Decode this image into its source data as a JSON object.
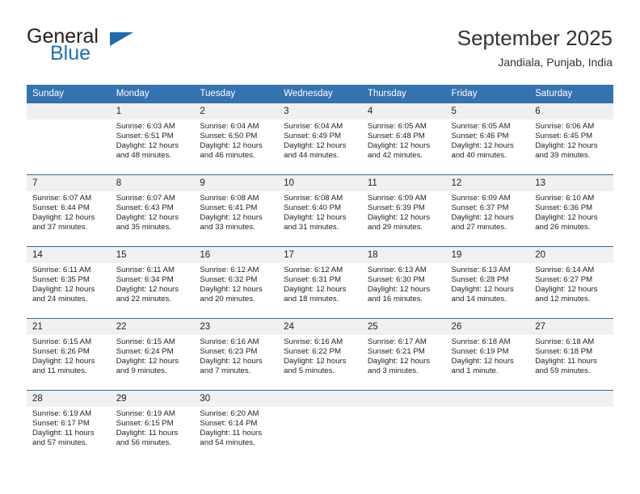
{
  "brand": {
    "word1": "General",
    "word2": "Blue",
    "accent_color": "#1c6cb0"
  },
  "header": {
    "month_title": "September 2025",
    "location": "Jandiala, Punjab, India",
    "header_bg": "#3572b0",
    "daynum_bg": "#f0f0f0",
    "row_border": "#2b6ca3"
  },
  "weekday_headers": [
    "Sunday",
    "Monday",
    "Tuesday",
    "Wednesday",
    "Thursday",
    "Friday",
    "Saturday"
  ],
  "weeks": [
    [
      {
        "day": "",
        "lines": []
      },
      {
        "day": "1",
        "lines": [
          "Sunrise: 6:03 AM",
          "Sunset: 6:51 PM",
          "Daylight: 12 hours",
          "and 48 minutes."
        ]
      },
      {
        "day": "2",
        "lines": [
          "Sunrise: 6:04 AM",
          "Sunset: 6:50 PM",
          "Daylight: 12 hours",
          "and 46 minutes."
        ]
      },
      {
        "day": "3",
        "lines": [
          "Sunrise: 6:04 AM",
          "Sunset: 6:49 PM",
          "Daylight: 12 hours",
          "and 44 minutes."
        ]
      },
      {
        "day": "4",
        "lines": [
          "Sunrise: 6:05 AM",
          "Sunset: 6:48 PM",
          "Daylight: 12 hours",
          "and 42 minutes."
        ]
      },
      {
        "day": "5",
        "lines": [
          "Sunrise: 6:05 AM",
          "Sunset: 6:46 PM",
          "Daylight: 12 hours",
          "and 40 minutes."
        ]
      },
      {
        "day": "6",
        "lines": [
          "Sunrise: 6:06 AM",
          "Sunset: 6:45 PM",
          "Daylight: 12 hours",
          "and 39 minutes."
        ]
      }
    ],
    [
      {
        "day": "7",
        "lines": [
          "Sunrise: 6:07 AM",
          "Sunset: 6:44 PM",
          "Daylight: 12 hours",
          "and 37 minutes."
        ]
      },
      {
        "day": "8",
        "lines": [
          "Sunrise: 6:07 AM",
          "Sunset: 6:43 PM",
          "Daylight: 12 hours",
          "and 35 minutes."
        ]
      },
      {
        "day": "9",
        "lines": [
          "Sunrise: 6:08 AM",
          "Sunset: 6:41 PM",
          "Daylight: 12 hours",
          "and 33 minutes."
        ]
      },
      {
        "day": "10",
        "lines": [
          "Sunrise: 6:08 AM",
          "Sunset: 6:40 PM",
          "Daylight: 12 hours",
          "and 31 minutes."
        ]
      },
      {
        "day": "11",
        "lines": [
          "Sunrise: 6:09 AM",
          "Sunset: 6:39 PM",
          "Daylight: 12 hours",
          "and 29 minutes."
        ]
      },
      {
        "day": "12",
        "lines": [
          "Sunrise: 6:09 AM",
          "Sunset: 6:37 PM",
          "Daylight: 12 hours",
          "and 27 minutes."
        ]
      },
      {
        "day": "13",
        "lines": [
          "Sunrise: 6:10 AM",
          "Sunset: 6:36 PM",
          "Daylight: 12 hours",
          "and 26 minutes."
        ]
      }
    ],
    [
      {
        "day": "14",
        "lines": [
          "Sunrise: 6:11 AM",
          "Sunset: 6:35 PM",
          "Daylight: 12 hours",
          "and 24 minutes."
        ]
      },
      {
        "day": "15",
        "lines": [
          "Sunrise: 6:11 AM",
          "Sunset: 6:34 PM",
          "Daylight: 12 hours",
          "and 22 minutes."
        ]
      },
      {
        "day": "16",
        "lines": [
          "Sunrise: 6:12 AM",
          "Sunset: 6:32 PM",
          "Daylight: 12 hours",
          "and 20 minutes."
        ]
      },
      {
        "day": "17",
        "lines": [
          "Sunrise: 6:12 AM",
          "Sunset: 6:31 PM",
          "Daylight: 12 hours",
          "and 18 minutes."
        ]
      },
      {
        "day": "18",
        "lines": [
          "Sunrise: 6:13 AM",
          "Sunset: 6:30 PM",
          "Daylight: 12 hours",
          "and 16 minutes."
        ]
      },
      {
        "day": "19",
        "lines": [
          "Sunrise: 6:13 AM",
          "Sunset: 6:28 PM",
          "Daylight: 12 hours",
          "and 14 minutes."
        ]
      },
      {
        "day": "20",
        "lines": [
          "Sunrise: 6:14 AM",
          "Sunset: 6:27 PM",
          "Daylight: 12 hours",
          "and 12 minutes."
        ]
      }
    ],
    [
      {
        "day": "21",
        "lines": [
          "Sunrise: 6:15 AM",
          "Sunset: 6:26 PM",
          "Daylight: 12 hours",
          "and 11 minutes."
        ]
      },
      {
        "day": "22",
        "lines": [
          "Sunrise: 6:15 AM",
          "Sunset: 6:24 PM",
          "Daylight: 12 hours",
          "and 9 minutes."
        ]
      },
      {
        "day": "23",
        "lines": [
          "Sunrise: 6:16 AM",
          "Sunset: 6:23 PM",
          "Daylight: 12 hours",
          "and 7 minutes."
        ]
      },
      {
        "day": "24",
        "lines": [
          "Sunrise: 6:16 AM",
          "Sunset: 6:22 PM",
          "Daylight: 12 hours",
          "and 5 minutes."
        ]
      },
      {
        "day": "25",
        "lines": [
          "Sunrise: 6:17 AM",
          "Sunset: 6:21 PM",
          "Daylight: 12 hours",
          "and 3 minutes."
        ]
      },
      {
        "day": "26",
        "lines": [
          "Sunrise: 6:18 AM",
          "Sunset: 6:19 PM",
          "Daylight: 12 hours",
          "and 1 minute."
        ]
      },
      {
        "day": "27",
        "lines": [
          "Sunrise: 6:18 AM",
          "Sunset: 6:18 PM",
          "Daylight: 11 hours",
          "and 59 minutes."
        ]
      }
    ],
    [
      {
        "day": "28",
        "lines": [
          "Sunrise: 6:19 AM",
          "Sunset: 6:17 PM",
          "Daylight: 11 hours",
          "and 57 minutes."
        ]
      },
      {
        "day": "29",
        "lines": [
          "Sunrise: 6:19 AM",
          "Sunset: 6:15 PM",
          "Daylight: 11 hours",
          "and 56 minutes."
        ]
      },
      {
        "day": "30",
        "lines": [
          "Sunrise: 6:20 AM",
          "Sunset: 6:14 PM",
          "Daylight: 11 hours",
          "and 54 minutes."
        ]
      },
      {
        "day": "",
        "lines": []
      },
      {
        "day": "",
        "lines": []
      },
      {
        "day": "",
        "lines": []
      },
      {
        "day": "",
        "lines": []
      }
    ]
  ]
}
